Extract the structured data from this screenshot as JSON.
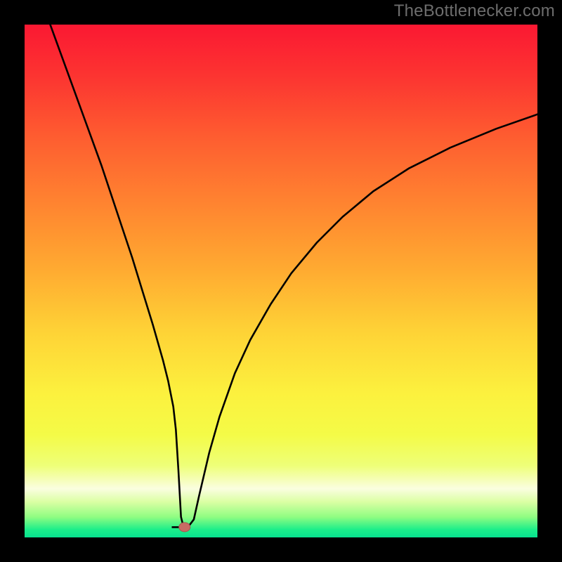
{
  "attribution": "TheBottlenecker.com",
  "colors": {
    "black": "#000000",
    "curve": "#000000",
    "marker_fill": "#c86b64",
    "marker_stroke": "#a85650"
  },
  "chart_data": {
    "type": "line",
    "title": "",
    "xlabel": "",
    "ylabel": "",
    "xlim": [
      0,
      100
    ],
    "ylim": [
      0,
      100
    ],
    "gradient_stops": [
      {
        "offset": 0.0,
        "color": "#fb1832"
      },
      {
        "offset": 0.1,
        "color": "#fc3431"
      },
      {
        "offset": 0.22,
        "color": "#fe5d30"
      },
      {
        "offset": 0.35,
        "color": "#ff8430"
      },
      {
        "offset": 0.48,
        "color": "#ffab31"
      },
      {
        "offset": 0.6,
        "color": "#fed336"
      },
      {
        "offset": 0.72,
        "color": "#fcf13e"
      },
      {
        "offset": 0.8,
        "color": "#f4fb47"
      },
      {
        "offset": 0.86,
        "color": "#eeff78"
      },
      {
        "offset": 0.905,
        "color": "#fafee0"
      },
      {
        "offset": 0.93,
        "color": "#dcffa5"
      },
      {
        "offset": 0.96,
        "color": "#90fd82"
      },
      {
        "offset": 0.985,
        "color": "#1bee8a"
      },
      {
        "offset": 1.0,
        "color": "#08e18f"
      }
    ],
    "curve": {
      "x": [
        5,
        7,
        9,
        11,
        13,
        15,
        17,
        19,
        21,
        23,
        25,
        27,
        28,
        29,
        29.5,
        30,
        30.5,
        31,
        32,
        33,
        34,
        36,
        38,
        41,
        44,
        48,
        52,
        57,
        62,
        68,
        75,
        83,
        92,
        100
      ],
      "y": [
        100,
        94.5,
        89,
        83.5,
        78,
        72.5,
        66.5,
        60.5,
        54.5,
        48,
        41.5,
        34.5,
        30.5,
        25.5,
        21,
        13,
        4,
        2,
        2.2,
        3.5,
        8,
        16.5,
        23.5,
        32,
        38.5,
        45.5,
        51.5,
        57.5,
        62.5,
        67.5,
        72,
        76,
        79.7,
        82.5
      ]
    },
    "flat_valley": {
      "x_from": 28.7,
      "x_to": 31.3,
      "y": 2
    },
    "marker": {
      "x": 31.2,
      "y": 2
    }
  }
}
